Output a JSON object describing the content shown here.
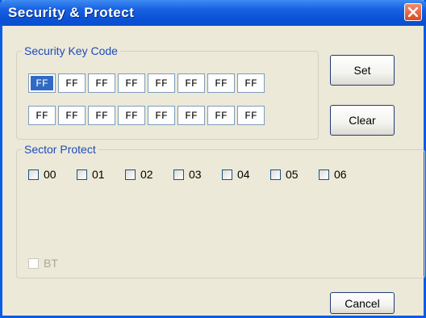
{
  "window": {
    "title": "Security & Protect"
  },
  "key_group": {
    "label": "Security Key Code",
    "row1": [
      "FF",
      "FF",
      "FF",
      "FF",
      "FF",
      "FF",
      "FF",
      "FF"
    ],
    "row2": [
      "FF",
      "FF",
      "FF",
      "FF",
      "FF",
      "FF",
      "FF",
      "FF"
    ]
  },
  "buttons": {
    "set": "Set",
    "clear": "Clear",
    "cancel": "Cancel"
  },
  "sector_group": {
    "label": "Sector Protect",
    "sectors": [
      "00",
      "01",
      "02",
      "03",
      "04",
      "05",
      "06"
    ],
    "bt_label": "BT"
  },
  "colors": {
    "titlebar": "#0b52d6",
    "close": "#d84a24",
    "group_label": "#1f4bb8"
  }
}
